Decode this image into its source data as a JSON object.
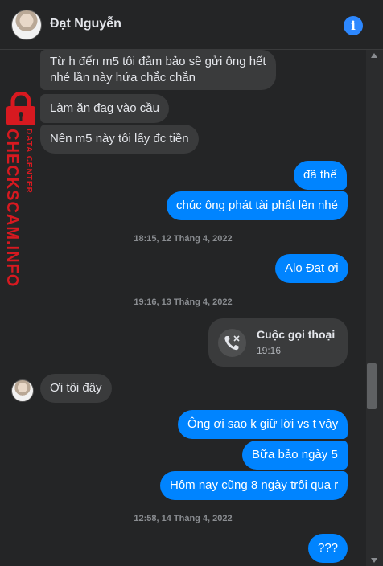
{
  "header": {
    "contact_name": "Đạt Nguyễn",
    "info_label": "i"
  },
  "messages": [
    {
      "dir": "in",
      "text": "Từ h đến m5 tôi đảm bảo sẽ gửi ông hết",
      "text2": "nhé lần này hứa chắc chắn"
    },
    {
      "dir": "in",
      "text": "Làm ăn đag vào cầu"
    },
    {
      "dir": "in",
      "text": "Nên m5 này tôi lấy đc tiền"
    },
    {
      "dir": "out",
      "text": "đã thế"
    },
    {
      "dir": "out",
      "text": "chúc ông phát tài phất lên nhé"
    },
    {
      "dir": "out",
      "text": "Alo Đạt ơi"
    },
    {
      "dir": "in",
      "text": "Ơi tôi đây"
    },
    {
      "dir": "out",
      "text": "Ông ơi sao k giữ lời vs t vậy"
    },
    {
      "dir": "out",
      "text": "Bữa bảo ngày 5"
    },
    {
      "dir": "out",
      "text": "Hôm nay cũng 8 ngày trôi qua r"
    },
    {
      "dir": "out",
      "text": "???"
    }
  ],
  "timestamps": [
    "18:15, 12 Tháng 4, 2022",
    "19:16, 13 Tháng 4, 2022",
    "12:58, 14 Tháng 4, 2022"
  ],
  "call": {
    "title": "Cuộc gọi thoại",
    "time": "19:16",
    "icon": "missed-call-icon"
  },
  "watermark": {
    "main": "CHECKSCAM.INFO",
    "sub": "DATA CENTER"
  },
  "colors": {
    "background": "#242526",
    "incoming": "#3a3b3c",
    "outgoing": "#0084ff",
    "watermark": "#d71920"
  }
}
